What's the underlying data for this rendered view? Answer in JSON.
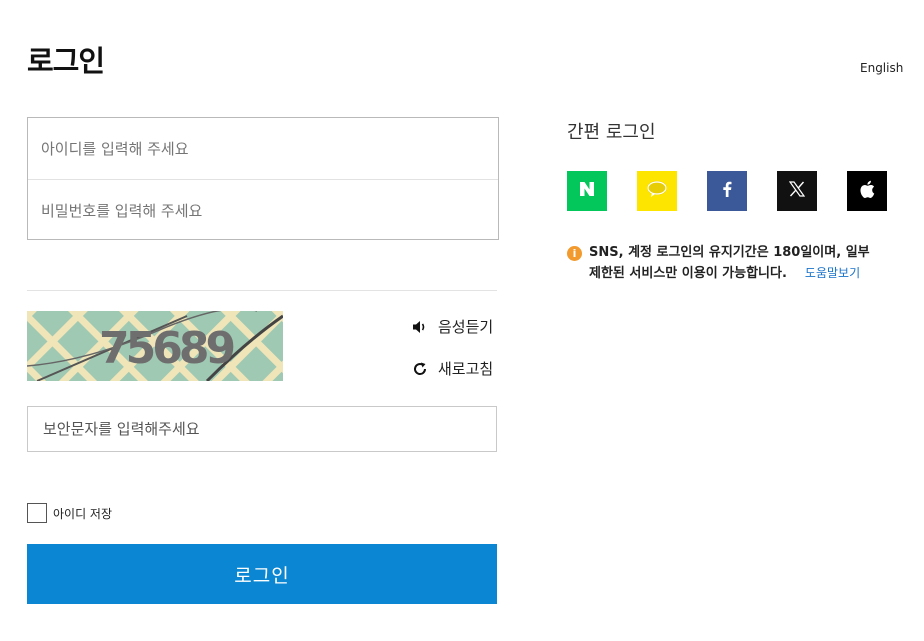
{
  "header": {
    "title": "로그인",
    "language_link": "English"
  },
  "login_form": {
    "id_placeholder": "아이디를 입력해 주세요",
    "password_placeholder": "비밀번호를 입력해 주세요",
    "captcha": {
      "image_text": "75689",
      "audio_label": "음성듣기",
      "refresh_label": "새로고침",
      "input_placeholder": "보안문자를 입력해주세요"
    },
    "remember_label": "아이디 저장",
    "submit_label": "로그인"
  },
  "sns_login": {
    "title": "간편 로그인",
    "providers": [
      {
        "name": "naver",
        "color": "#03c75a",
        "icon": "naver-icon"
      },
      {
        "name": "kakao",
        "color": "#fee500",
        "icon": "kakao-icon"
      },
      {
        "name": "facebook",
        "color": "#3b5998",
        "icon": "facebook-icon"
      },
      {
        "name": "x",
        "color": "#111111",
        "icon": "x-icon"
      },
      {
        "name": "apple",
        "color": "#000000",
        "icon": "apple-icon"
      }
    ],
    "notice_line1": "SNS, 계정 로그인의 유지기간은 180일이며, 일부",
    "notice_line2": "제한된 서비스만 이용이 가능합니다.",
    "help_link": "도움말보기"
  },
  "colors": {
    "primary": "#0a86d2",
    "warning": "#f29a2e",
    "link": "#1a73c9"
  }
}
